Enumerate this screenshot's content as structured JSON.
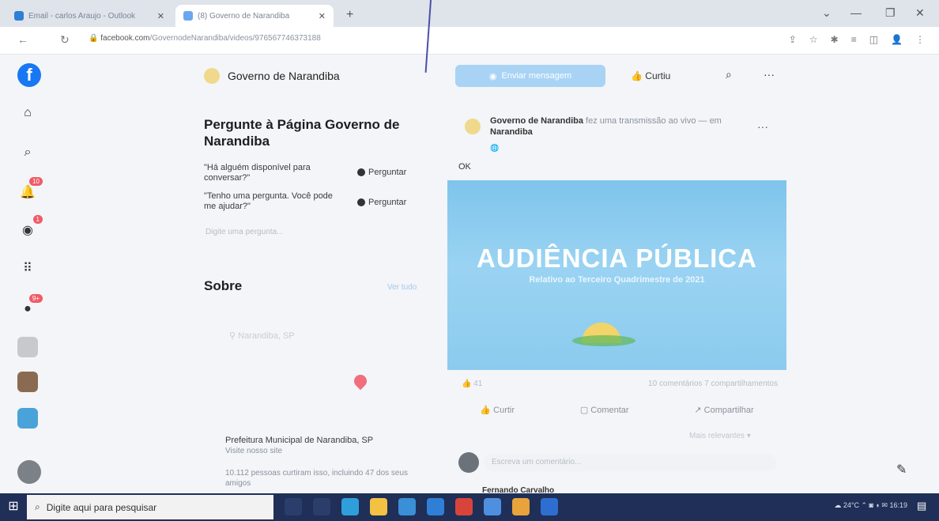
{
  "browser": {
    "tabs": [
      {
        "label": "Email - carlos Araujo - Outlook"
      },
      {
        "label": "(8) Governo de Narandiba"
      }
    ],
    "new_tab": "+",
    "url_host": "facebook.com",
    "url_path": "/GovernodeNarandiba/videos/976567746373188"
  },
  "rail": {
    "badges": {
      "notifications": "10",
      "messenger": "1",
      "groups": "9+"
    }
  },
  "header": {
    "page_name": "Governo de Narandiba",
    "send_message": "Enviar mensagem",
    "liked": "Curtiu"
  },
  "ask": {
    "title": "Pergunte à Página Governo de Narandiba",
    "suggestions": [
      {
        "text": "\"Há alguém disponível para conversar?\"",
        "action": "Perguntar"
      },
      {
        "text": "\"Tenho uma pergunta. Você pode me ajudar?\"",
        "action": "Perguntar"
      }
    ],
    "input_placeholder": "Digite uma pergunta..."
  },
  "about": {
    "title": "Sobre",
    "see_all": "Ver tudo",
    "location": "Narandiba, SP",
    "org_name": "Prefeitura Municipal de Narandiba, SP",
    "site_text": "Visite nosso site",
    "likes_text": "10.112 pessoas curtiram isso, incluindo 47 dos seus amigos"
  },
  "post": {
    "author": "Governo de Narandiba",
    "action": "fez uma transmissão ao vivo —",
    "at_prefix": "em",
    "place": "Narandiba",
    "text": "OK",
    "banner_title": "AUDIÊNCIA PÚBLICA",
    "banner_subtitle": "Relativo ao Terceiro Quadrimestre de 2021",
    "reactions": "41",
    "stats": "10 comentários 7 compartilhamentos",
    "actions": [
      "Curtir",
      "Comentar",
      "Compartilhar"
    ],
    "sort": "Mais relevantes",
    "comment_placeholder": "Escreva um comentário...",
    "first_commenter": "Fernando Carvalho"
  },
  "taskbar": {
    "search_placeholder": "Digite aqui para pesquisar",
    "temperature": "24°C",
    "time": "16:19"
  },
  "colors": {
    "facebook_blue": "#1877f2",
    "banner_blue": "#8ccbee",
    "taskbar": "#1f2f57"
  }
}
